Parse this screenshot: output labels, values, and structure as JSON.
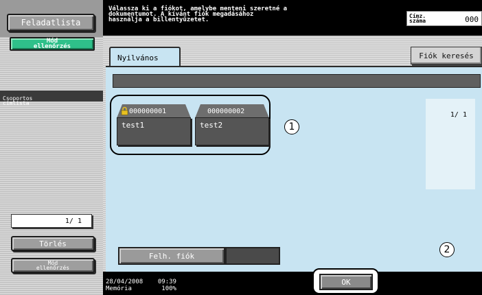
{
  "left_panel": {
    "task_list_label": "Feladatlista",
    "mode_check_top_label": "Mód\nellenőrzés",
    "group_address_label": "Csoportos\ncímlista",
    "pager": "1/  1",
    "delete_label": "Törlés",
    "mode_check_bottom_label": "Mód\nellenőrzés"
  },
  "message": {
    "text": "Válassza ki a fiókot, amelybe menteni szeretné a\ndokumentumot. A kívánt fiók megadásához\nhasználja a billentyűzetet.",
    "count_label": "Címz.\nszáma",
    "count_value": "000"
  },
  "tabs": [
    {
      "label": "Nyilvános"
    }
  ],
  "search_button_label": "Fiók keresés",
  "accounts": [
    {
      "number": "000000001",
      "name": "test1",
      "locked": true
    },
    {
      "number": "000000002",
      "name": "test2",
      "locked": false
    }
  ],
  "annotations": {
    "callout_1": "1",
    "callout_2": "2"
  },
  "page_indicator": "1/  1",
  "user_account_label": "Felh. fiók",
  "status": {
    "datetime": "28/04/2008    09:39",
    "memory": "Memória        100%"
  },
  "ok_label": "OK"
}
